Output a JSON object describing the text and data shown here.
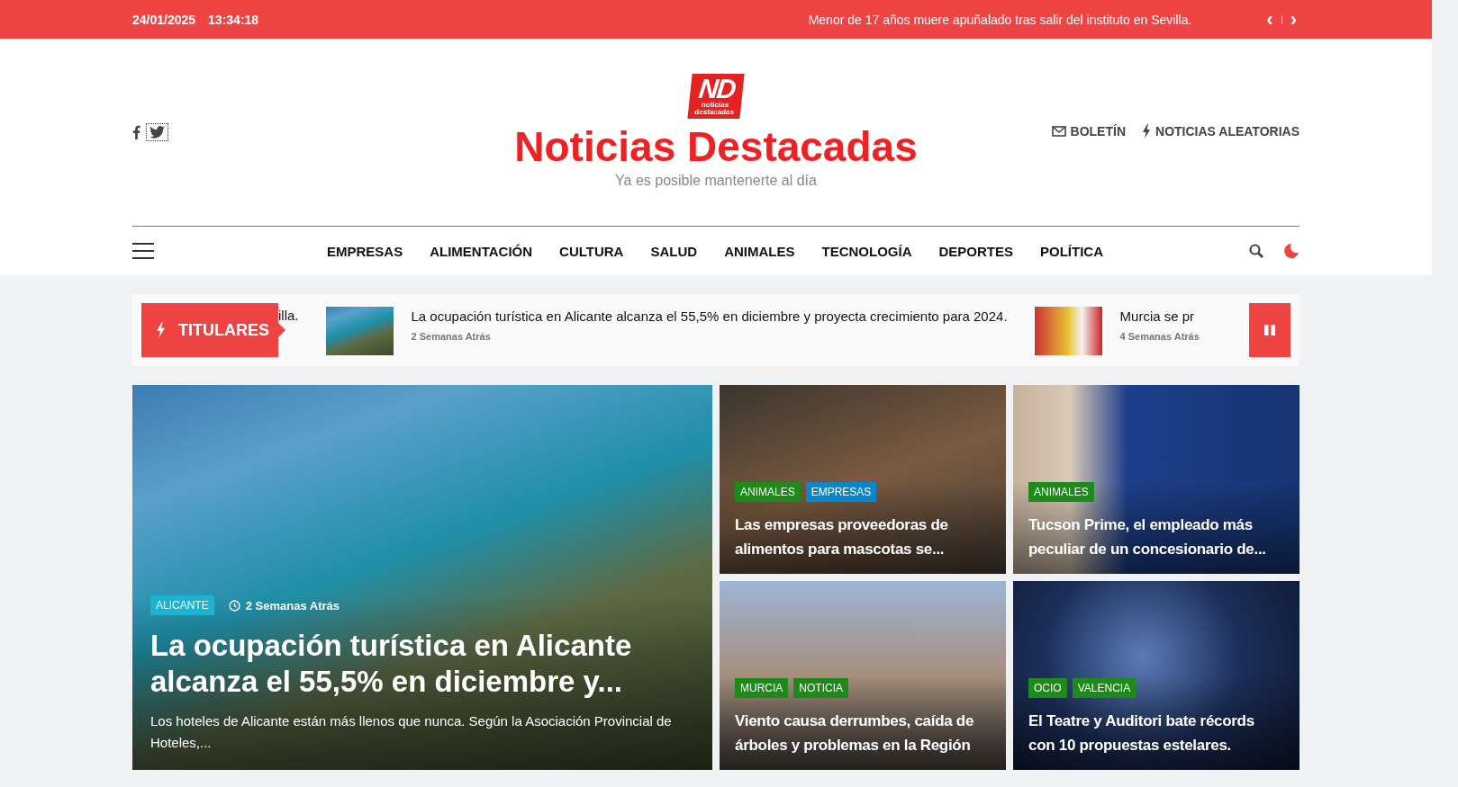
{
  "top_bar": {
    "date": "24/01/2025",
    "time": "13:34:18",
    "headline": "Menor de 17 años muere apuñalado tras salir del instituto en Sevilla.",
    "prev": "‹",
    "next": "›"
  },
  "header": {
    "logo_mark": "ND",
    "logo_small": "noticias destacadas",
    "site_title": "Noticias Destacadas",
    "tagline": "Ya es posible mantenerte al día",
    "links": [
      {
        "kind": "mail",
        "label": "BOLETÍN"
      },
      {
        "kind": "bolt",
        "label": "NOTICIAS ALEATORIAS"
      }
    ]
  },
  "nav": {
    "items": [
      "EMPRESAS",
      "ALIMENTACIÓN",
      "CULTURA",
      "SALUD",
      "ANIMALES",
      "TECNOLOGÍA",
      "DEPORTES",
      "POLÍTICA"
    ]
  },
  "ticker": {
    "label": "TITULARES",
    "items": [
      {
        "kind": "text",
        "title": "illa."
      },
      {
        "kind": "story",
        "title": "La ocupación turística en Alicante alcanza el 55,5% en diciembre y proyecta crecimiento para 2024.",
        "time": "2 Semanas Atrás"
      },
      {
        "kind": "story",
        "title": "Murcia se pr",
        "time": "4 Semanas Atrás"
      }
    ]
  },
  "featured": {
    "tags": [
      {
        "label": "ALICANTE",
        "color": "#1bb3d4"
      }
    ],
    "time": "2 Semanas Atrás",
    "title": "La ocupación turística en Alicante alcanza el 55,5% en diciembre y...",
    "excerpt": "Los hoteles de Alicante están más llenos que nunca. Según la Asociación Provincial de Hoteles,..."
  },
  "cards": [
    {
      "tags": [
        {
          "label": "ANIMALES",
          "color": "#1e8a1a"
        },
        {
          "label": "EMPRESAS",
          "color": "#0a86cc"
        }
      ],
      "title": "Las empresas proveedoras de alimentos para mascotas se..."
    },
    {
      "tags": [
        {
          "label": "ANIMALES",
          "color": "#1e8a1a"
        }
      ],
      "title": "Tucson Prime, el empleado más peculiar de un concesionario de..."
    },
    {
      "tags": [
        {
          "label": "MURCIA",
          "color": "#1e8a1a"
        },
        {
          "label": "NOTICIA",
          "color": "#1e8a1a"
        }
      ],
      "title": "Viento causa derrumbes, caída de árboles y problemas en la Región"
    },
    {
      "tags": [
        {
          "label": "OCIO",
          "color": "#1e8a1a"
        },
        {
          "label": "VALENCIA",
          "color": "#1e8a1a"
        }
      ],
      "title": "El Teatre y Auditori bate récords con 10 propuestas estelares."
    }
  ]
}
